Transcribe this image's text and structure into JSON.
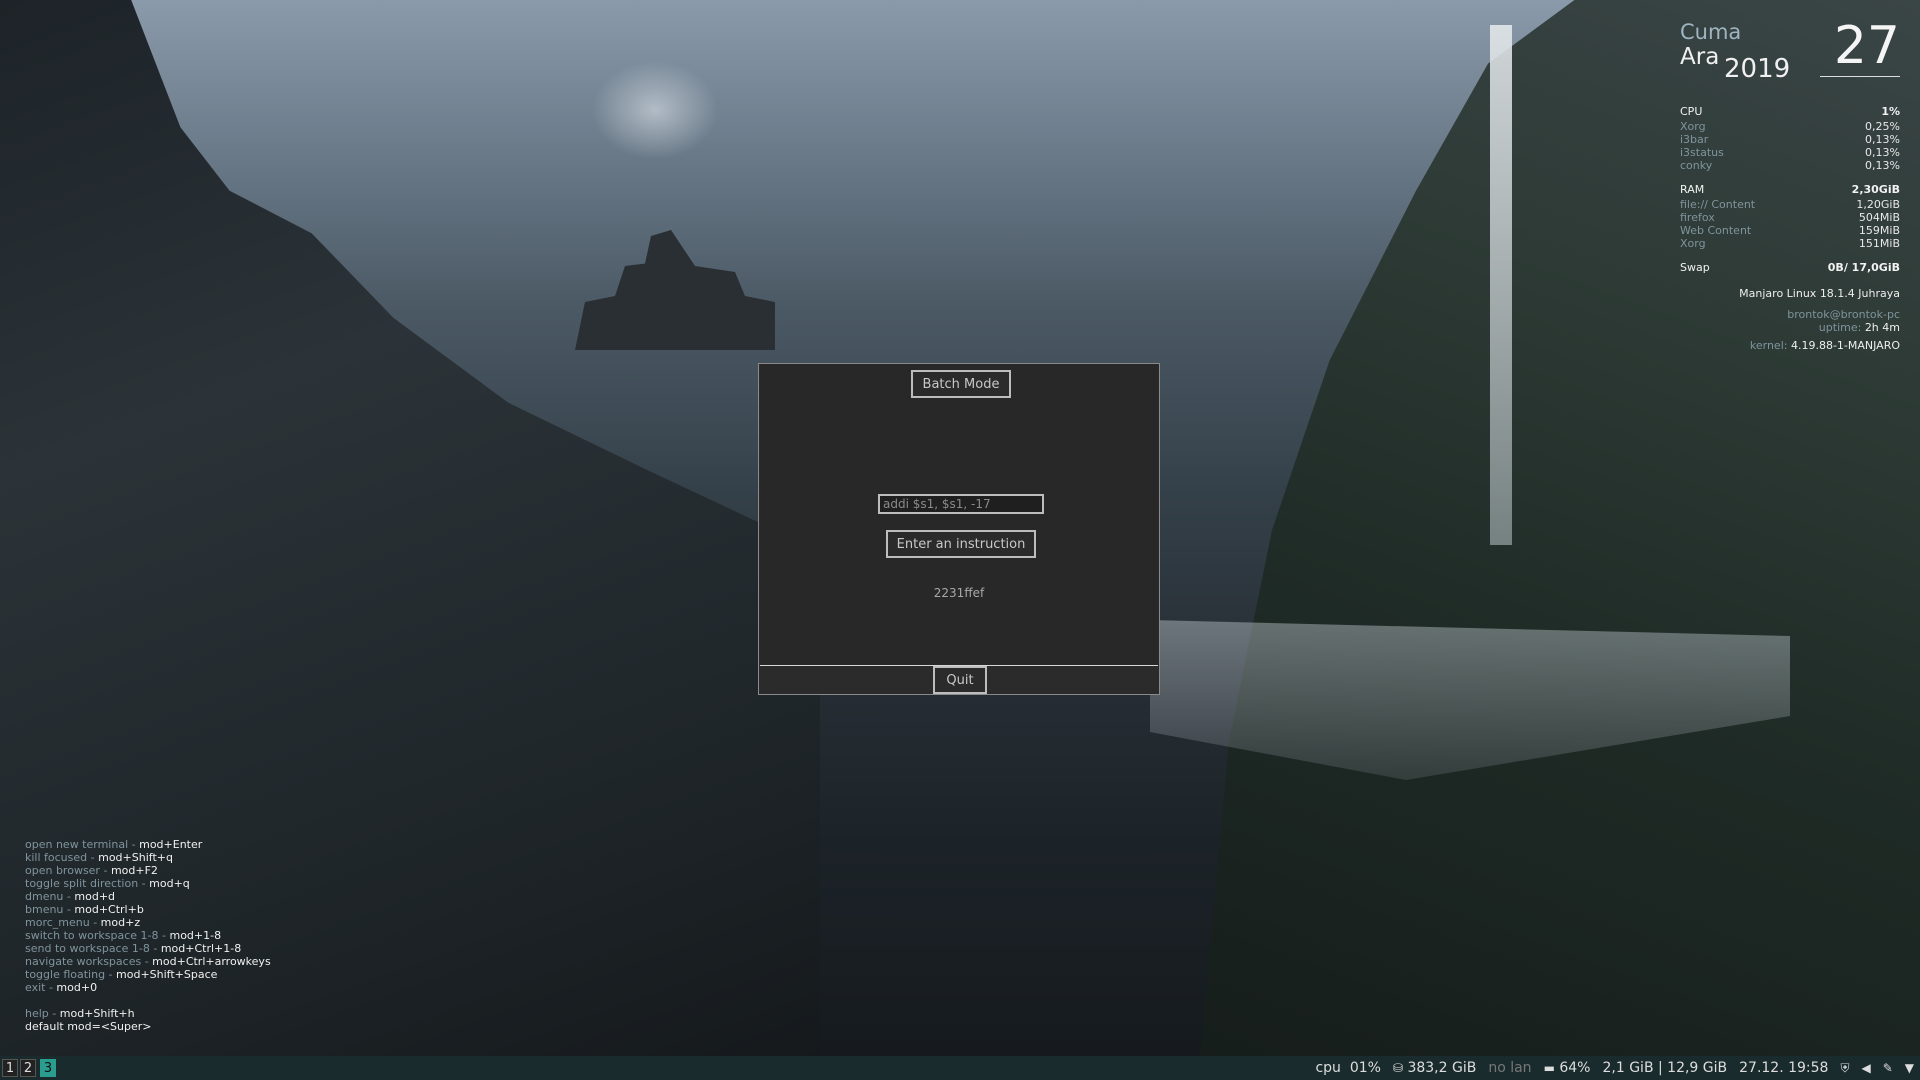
{
  "conky": {
    "day_of_week": "Cuma",
    "month": "Ara",
    "year": "2019",
    "day": "27",
    "cpu": {
      "label": "CPU",
      "value": "1%",
      "procs": [
        {
          "name": "Xorg",
          "value": "0,25%"
        },
        {
          "name": "i3bar",
          "value": "0,13%"
        },
        {
          "name": "i3status",
          "value": "0,13%"
        },
        {
          "name": "conky",
          "value": "0,13%"
        }
      ]
    },
    "ram": {
      "label": "RAM",
      "value": "2,30GiB",
      "procs": [
        {
          "name": "file:// Content",
          "value": "1,20GiB"
        },
        {
          "name": "firefox",
          "value": "504MiB"
        },
        {
          "name": "Web Content",
          "value": "159MiB"
        },
        {
          "name": "Xorg",
          "value": "151MiB"
        }
      ]
    },
    "swap": {
      "label": "Swap",
      "value": "0B/ 17,0GiB"
    },
    "distro": "Manjaro Linux 18.1.4 Juhraya",
    "user": "brontok@brontok-pc",
    "uptime_label": "uptime:",
    "uptime": "2h 4m",
    "kernel_label": "kernel:",
    "kernel": "4.19.88-1-MANJARO"
  },
  "app": {
    "batch_label": "Batch Mode",
    "input_placeholder": "addi $s1, $s1, -17",
    "enter_label": "Enter an instruction",
    "result": "2231ffef",
    "quit_label": "Quit"
  },
  "help": {
    "items": [
      {
        "desc": "open new terminal",
        "keys": "mod+Enter"
      },
      {
        "desc": "kill focused",
        "keys": "mod+Shift+q"
      },
      {
        "desc": "open browser",
        "keys": "mod+F2"
      },
      {
        "desc": "toggle split direction",
        "keys": "mod+q"
      },
      {
        "desc": "dmenu",
        "keys": "mod+d"
      },
      {
        "desc": "bmenu",
        "keys": "mod+Ctrl+b"
      },
      {
        "desc": "morc_menu",
        "keys": "mod+z"
      },
      {
        "desc": "switch to workspace 1-8",
        "keys": "mod+1-8"
      },
      {
        "desc": "send to workspace 1-8",
        "keys": "mod+Ctrl+1-8"
      },
      {
        "desc": "navigate workspaces",
        "keys": "mod+Ctrl+arrowkeys"
      },
      {
        "desc": "toggle floating",
        "keys": "mod+Shift+Space"
      },
      {
        "desc": "exit",
        "keys": "mod+0"
      }
    ],
    "help_desc": "help",
    "help_keys": "mod+Shift+h",
    "default_mod": "default mod=<Super>"
  },
  "bar": {
    "workspaces": [
      "1",
      "2",
      "3"
    ],
    "active_workspace": "3",
    "cpu_label": "cpu",
    "cpu_value": "01%",
    "disk": "383,2 GiB",
    "lan": "no lan",
    "battery": "64%",
    "memory": "2,1 GiB | 12,9 GiB",
    "datetime": "27.12. 19:58",
    "accent": "#2a9d8f"
  }
}
